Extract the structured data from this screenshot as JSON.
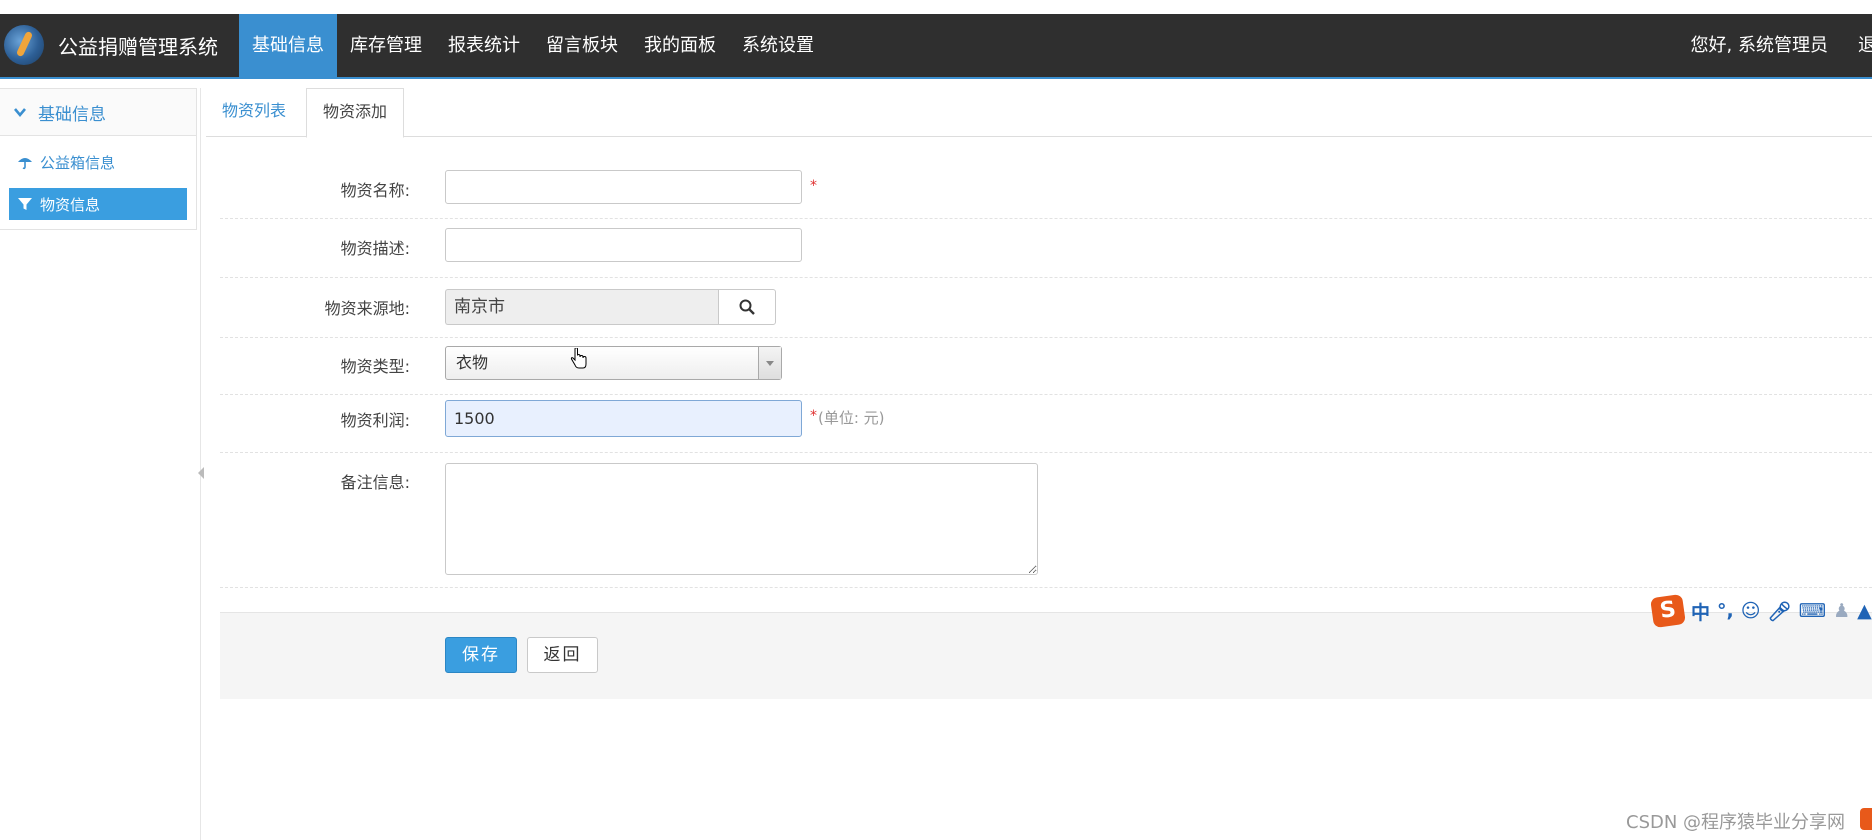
{
  "app": {
    "title": "公益捐赠管理系统"
  },
  "nav": {
    "items": [
      {
        "label": "基础信息",
        "active": true
      },
      {
        "label": "库存管理",
        "active": false
      },
      {
        "label": "报表统计",
        "active": false
      },
      {
        "label": "留言板块",
        "active": false
      },
      {
        "label": "我的面板",
        "active": false
      },
      {
        "label": "系统设置",
        "active": false
      }
    ],
    "greeting": "您好, 系统管理员",
    "logout": "退"
  },
  "sidebar": {
    "header": "基础信息",
    "items": [
      {
        "label": "公益箱信息",
        "active": false,
        "icon": "umbrella-icon"
      },
      {
        "label": "物资信息",
        "active": true,
        "icon": "filter-icon"
      }
    ]
  },
  "tabs": [
    {
      "label": "物资列表",
      "active": false
    },
    {
      "label": "物资添加",
      "active": true
    }
  ],
  "form": {
    "name": {
      "label": "物资名称:",
      "value": "",
      "required_mark": "*"
    },
    "desc": {
      "label": "物资描述:",
      "value": ""
    },
    "origin": {
      "label": "物资来源地:",
      "value": "南京市"
    },
    "type": {
      "label": "物资类型:",
      "selected": "衣物"
    },
    "profit": {
      "label": "物资利润:",
      "value": "1500",
      "required_mark": "*",
      "hint": "(单位: 元)"
    },
    "remark": {
      "label": "备注信息:",
      "value": ""
    }
  },
  "buttons": {
    "save": "保存",
    "back": "返回"
  },
  "ime": {
    "logo": "S",
    "mode": "中"
  },
  "watermark": "CSDN @程序猿毕业分享网",
  "colors": {
    "navbar": "#2f2f2f",
    "accent": "#3a8fd0",
    "primary_button": "#3a9ee0",
    "required": "#e03030"
  }
}
